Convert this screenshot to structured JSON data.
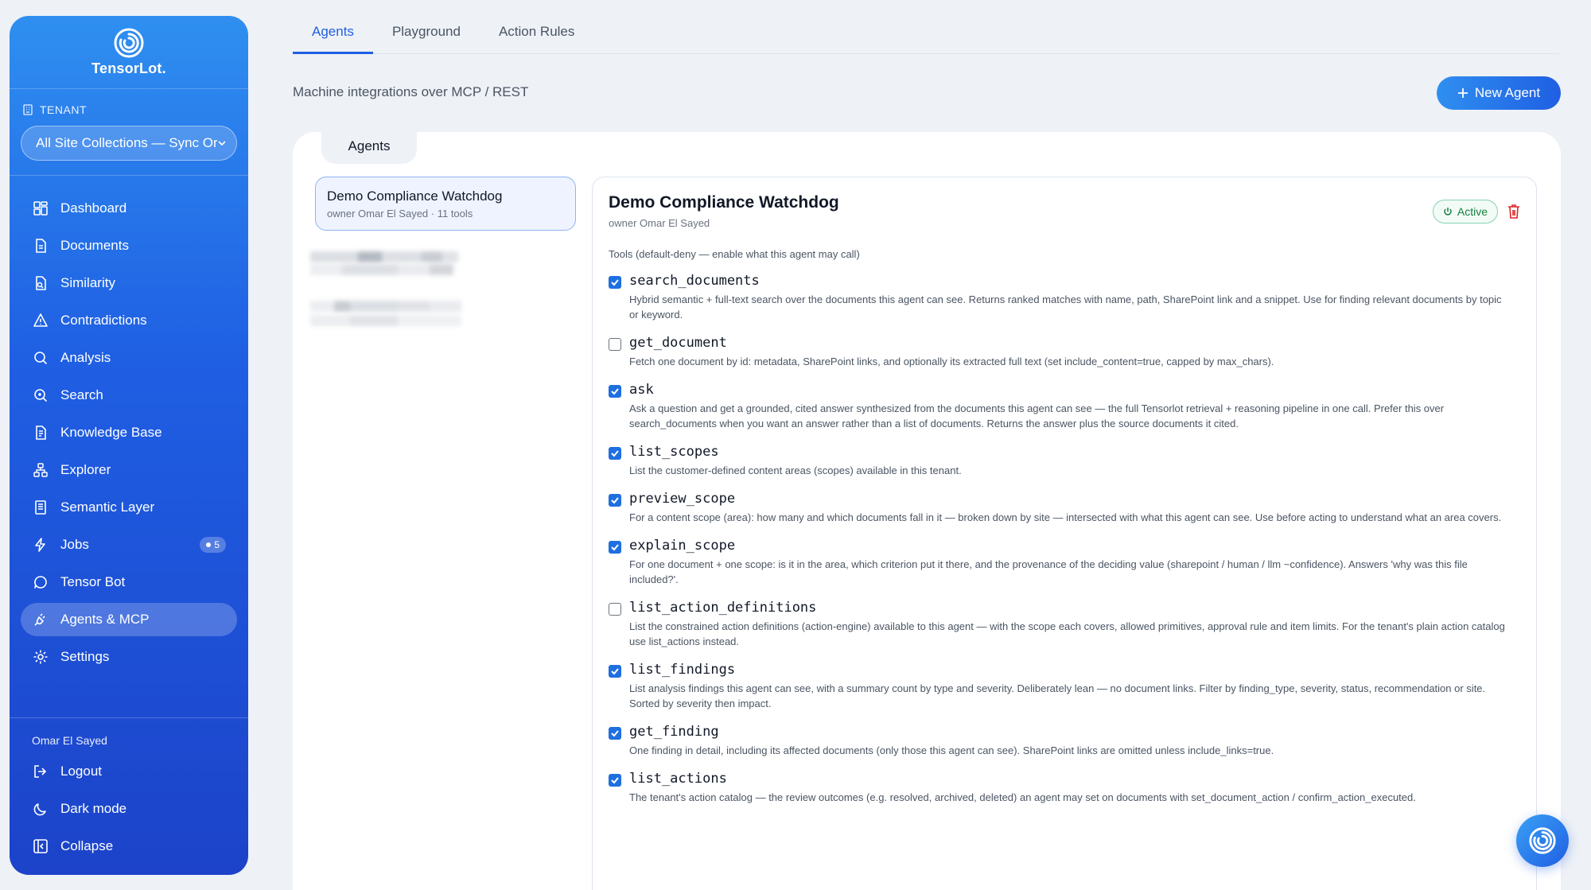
{
  "brand": {
    "name": "TensorLot."
  },
  "tenant": {
    "label": "TENANT",
    "selected": "All Site Collections — Sync Or"
  },
  "nav": [
    {
      "label": "Dashboard",
      "icon": "dashboard-icon"
    },
    {
      "label": "Documents",
      "icon": "document-icon"
    },
    {
      "label": "Similarity",
      "icon": "similarity-icon"
    },
    {
      "label": "Contradictions",
      "icon": "warning-icon"
    },
    {
      "label": "Analysis",
      "icon": "search-icon"
    },
    {
      "label": "Search",
      "icon": "search-plus-icon"
    },
    {
      "label": "Knowledge Base",
      "icon": "book-icon"
    },
    {
      "label": "Explorer",
      "icon": "hierarchy-icon"
    },
    {
      "label": "Semantic Layer",
      "icon": "layers-icon"
    },
    {
      "label": "Jobs",
      "icon": "lightning-icon",
      "badge": "5"
    },
    {
      "label": "Tensor Bot",
      "icon": "chat-icon"
    },
    {
      "label": "Agents & MCP",
      "icon": "plug-icon",
      "active": true
    },
    {
      "label": "Settings",
      "icon": "gear-icon"
    }
  ],
  "footer": {
    "user": "Omar El Sayed",
    "items": [
      {
        "label": "Logout",
        "icon": "logout-icon"
      },
      {
        "label": "Dark mode",
        "icon": "moon-icon"
      },
      {
        "label": "Collapse",
        "icon": "collapse-icon"
      }
    ]
  },
  "tabs": [
    "Agents",
    "Playground",
    "Action Rules"
  ],
  "subtitle": "Machine integrations over MCP / REST",
  "new_agent_label": "New Agent",
  "panel_tab": "Agents",
  "agent_card": {
    "name": "Demo Compliance Watchdog",
    "meta": "owner Omar El Sayed · 11 tools"
  },
  "detail": {
    "title": "Demo Compliance Watchdog",
    "owner": "owner Omar El Sayed",
    "status": "Active",
    "tools_label": "Tools (default-deny — enable what this agent may call)",
    "tools": [
      {
        "name": "search_documents",
        "checked": true,
        "desc": "Hybrid semantic + full-text search over the documents this agent can see. Returns ranked matches with name, path, SharePoint link and a snippet. Use for finding relevant documents by topic or keyword."
      },
      {
        "name": "get_document",
        "checked": false,
        "desc": "Fetch one document by id: metadata, SharePoint links, and optionally its extracted full text (set include_content=true, capped by max_chars)."
      },
      {
        "name": "ask",
        "checked": true,
        "desc": "Ask a question and get a grounded, cited answer synthesized from the documents this agent can see — the full Tensorlot retrieval + reasoning pipeline in one call. Prefer this over search_documents when you want an answer rather than a list of documents. Returns the answer plus the source documents it cited."
      },
      {
        "name": "list_scopes",
        "checked": true,
        "desc": "List the customer-defined content areas (scopes) available in this tenant."
      },
      {
        "name": "preview_scope",
        "checked": true,
        "desc": "For a content scope (area): how many and which documents fall in it — broken down by site — intersected with what this agent can see. Use before acting to understand what an area covers."
      },
      {
        "name": "explain_scope",
        "checked": true,
        "desc": "For one document + one scope: is it in the area, which criterion put it there, and the provenance of the deciding value (sharepoint / human / llm ~confidence). Answers 'why was this file included?'."
      },
      {
        "name": "list_action_definitions",
        "checked": false,
        "desc": "List the constrained action definitions (action-engine) available to this agent — with the scope each covers, allowed primitives, approval rule and item limits. For the tenant's plain action catalog use list_actions instead."
      },
      {
        "name": "list_findings",
        "checked": true,
        "desc": "List analysis findings this agent can see, with a summary count by type and severity. Deliberately lean — no document links. Filter by finding_type, severity, status, recommendation or site. Sorted by severity then impact."
      },
      {
        "name": "get_finding",
        "checked": true,
        "desc": "One finding in detail, including its affected documents (only those this agent can see). SharePoint links are omitted unless include_links=true."
      },
      {
        "name": "list_actions",
        "checked": true,
        "desc": "The tenant's action catalog — the review outcomes (e.g. resolved, archived, deleted) an agent may set on documents with set_document_action / confirm_action_executed."
      }
    ]
  },
  "colors": {
    "accent": "#1f5fe3",
    "sidebar_top": "#2f8ff0",
    "sidebar_bottom": "#1c43c9",
    "active_green": "#15803d",
    "danger": "#dc2626"
  }
}
